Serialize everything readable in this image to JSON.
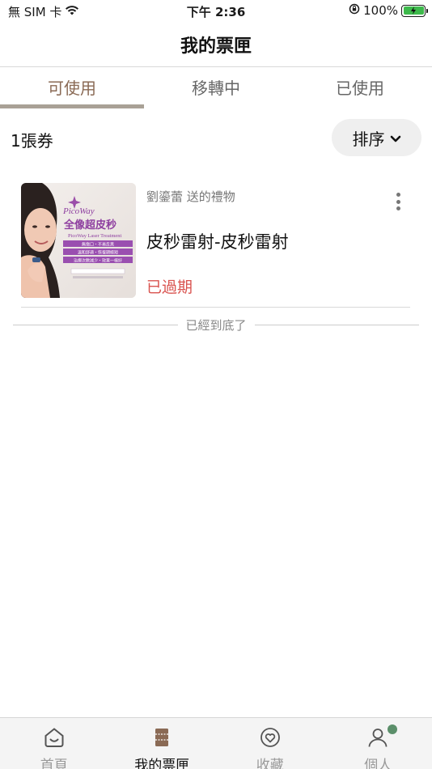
{
  "status_bar": {
    "carrier": "無 SIM 卡",
    "time": "下午 2:36",
    "battery": "100%"
  },
  "header": {
    "title": "我的票匣"
  },
  "tabs": [
    {
      "label": "可使用",
      "active": true
    },
    {
      "label": "移轉中",
      "active": false
    },
    {
      "label": "已使用",
      "active": false
    }
  ],
  "summary": {
    "count_label": "1張券",
    "sort_label": "排序"
  },
  "tickets": [
    {
      "giver_text": "劉鎏蕾 送的禮物",
      "title": "皮秒雷射-皮秒雷射",
      "status": "已過期",
      "thumbnail": {
        "brand": "PicoWay",
        "headline": "全像超皮秒",
        "subheadline": "PicoWay Laser Treatment",
        "bullets": [
          "無傷口・不易反黑",
          "溫和舒適・恢復期極短",
          "治療次數減少・效果一樣好"
        ]
      }
    }
  ],
  "end_text": "已經到底了",
  "bottom_nav": [
    {
      "label": "首頁",
      "icon": "home-icon",
      "active": false
    },
    {
      "label": "我的票匣",
      "icon": "ticket-wallet-icon",
      "active": true
    },
    {
      "label": "收藏",
      "icon": "heart-icon",
      "active": false
    },
    {
      "label": "個人",
      "icon": "person-icon",
      "active": false,
      "has_badge": true
    }
  ],
  "colors": {
    "accent": "#8a6a55",
    "tab_indicator": "#a9a196",
    "expired": "#d9534f",
    "battery": "#3db94b",
    "badge": "#5b8f6a",
    "thumb_purple": "#8e3fa0"
  }
}
